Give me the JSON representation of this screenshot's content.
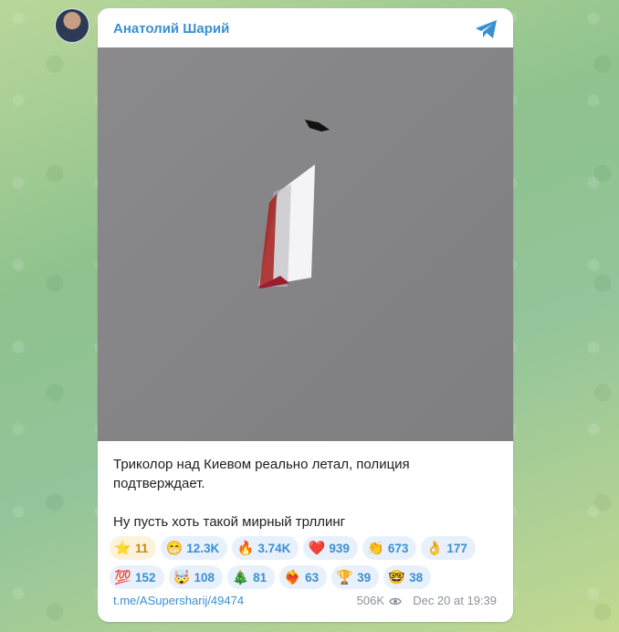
{
  "channel": {
    "name": "Анатолий Шарий"
  },
  "post": {
    "text_line1": "Триколор над Киевом реально летал, полиция",
    "text_line2": "подтверждает.",
    "text_line3": "Ну пусть хоть такой мирный трллинг"
  },
  "reactions": [
    {
      "emoji": "⭐",
      "count": "11",
      "name": "star"
    },
    {
      "emoji": "😁",
      "count": "12.3K",
      "name": "grin"
    },
    {
      "emoji": "🔥",
      "count": "3.74K",
      "name": "fire"
    },
    {
      "emoji": "❤️",
      "count": "939",
      "name": "heart"
    },
    {
      "emoji": "👏",
      "count": "673",
      "name": "clap"
    },
    {
      "emoji": "👌",
      "count": "177",
      "name": "ok-hand"
    },
    {
      "emoji": "💯",
      "count": "152",
      "name": "hundred"
    },
    {
      "emoji": "🤯",
      "count": "108",
      "name": "mind-blown"
    },
    {
      "emoji": "🎄",
      "count": "81",
      "name": "christmas-tree"
    },
    {
      "emoji": "❤️‍🔥",
      "count": "63",
      "name": "heart-on-fire"
    },
    {
      "emoji": "🏆",
      "count": "39",
      "name": "trophy"
    },
    {
      "emoji": "🤓",
      "count": "38",
      "name": "nerd"
    }
  ],
  "footer": {
    "link": "t.me/ASupersharij/49474",
    "views": "506K",
    "date": "Dec 20 at 19:39"
  },
  "colors": {
    "accent": "#3a8fd3",
    "card": "#ffffff"
  }
}
